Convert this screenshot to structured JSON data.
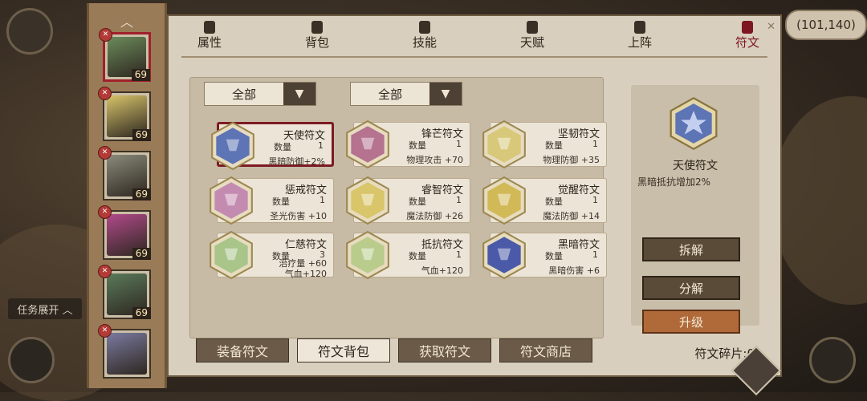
{
  "coords": "(101,140)",
  "task_toggle": "任务展开",
  "tabs": [
    {
      "label": "属性",
      "icon": "flame-icon"
    },
    {
      "label": "背包",
      "icon": "bag-icon"
    },
    {
      "label": "技能",
      "icon": "book-icon"
    },
    {
      "label": "天赋",
      "icon": "eye-icon"
    },
    {
      "label": "上阵",
      "icon": "swords-icon"
    },
    {
      "label": "符文",
      "icon": "rune-icon"
    }
  ],
  "filters": {
    "left": "全部",
    "right": "全部"
  },
  "heroes": [
    {
      "level": "69",
      "color": "#6b8a5a"
    },
    {
      "level": "69",
      "color": "#d7c46a"
    },
    {
      "level": "69",
      "color": "#8a8a7a"
    },
    {
      "level": "69",
      "color": "#b14a8a"
    },
    {
      "level": "69",
      "color": "#5a7a5a"
    },
    {
      "level": "",
      "color": "#7a7aa0"
    }
  ],
  "quantity_label": "数量",
  "runes": [
    {
      "name": "天使符文",
      "qty": "1",
      "stat": "黑暗防御+2%",
      "color": "#5d74b5",
      "selected": true
    },
    {
      "name": "锋芒符文",
      "qty": "1",
      "stat": "物理攻击 +70",
      "color": "#b57390"
    },
    {
      "name": "坚韧符文",
      "qty": "1",
      "stat": "物理防御 +35",
      "color": "#d8c87a"
    },
    {
      "name": "惩戒符文",
      "qty": "1",
      "stat": "圣光伤害 +10",
      "color": "#c48bb0"
    },
    {
      "name": "睿智符文",
      "qty": "1",
      "stat": "魔法防御 +26",
      "color": "#d9c56a"
    },
    {
      "name": "觉醒符文",
      "qty": "1",
      "stat": "魔法防御 +14",
      "color": "#d2b958"
    },
    {
      "name": "仁慈符文",
      "qty": "3",
      "stat": "治疗量 +60",
      "stat2": "气血+120",
      "color": "#a9c58a"
    },
    {
      "name": "抵抗符文",
      "qty": "1",
      "stat": "气血+120",
      "color": "#b9cc8c"
    },
    {
      "name": "黑暗符文",
      "qty": "1",
      "stat": "黑暗伤害 +6",
      "color": "#4a5aa8"
    }
  ],
  "detail": {
    "name": "天使符文",
    "desc": "黑暗抵抗增加2%"
  },
  "actions": {
    "dismantle": "拆解",
    "decompose": "分解",
    "upgrade": "升级"
  },
  "bottom_tabs": [
    "装备符文",
    "符文背包",
    "获取符文",
    "符文商店"
  ],
  "fragments": "符文碎片:0"
}
